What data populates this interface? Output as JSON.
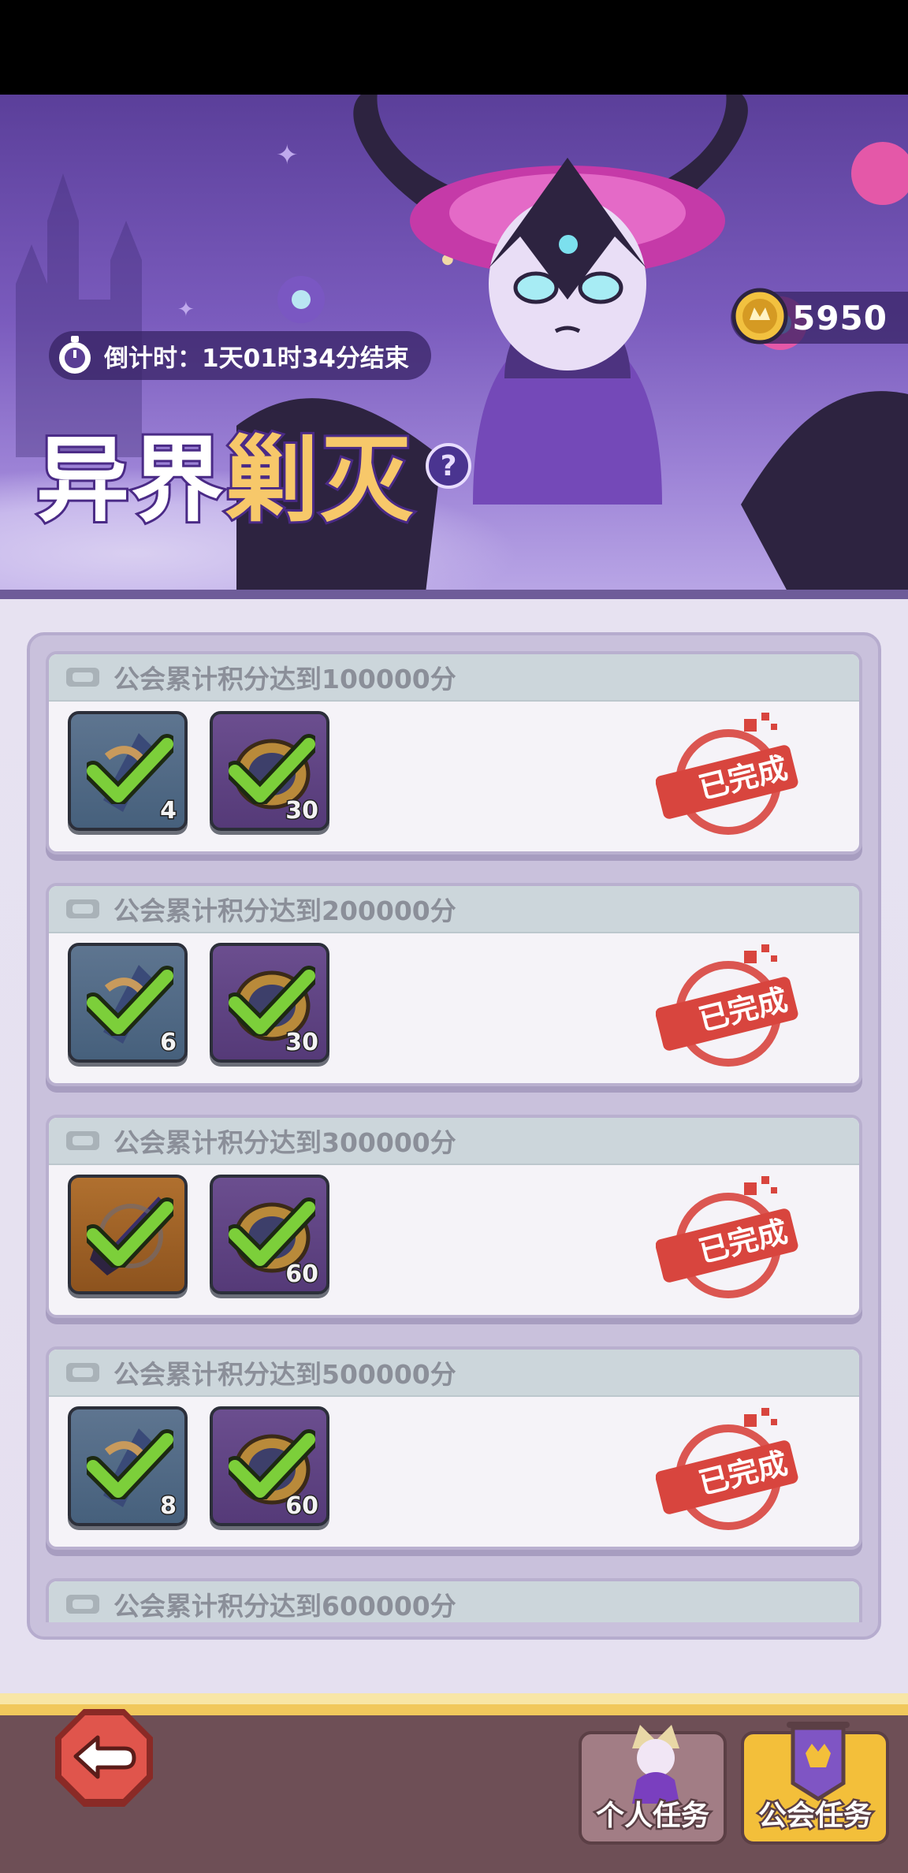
{
  "header": {
    "countdown": "倒计时：1天01时34分结束",
    "title_white": "异界",
    "title_gold": "剿灭",
    "help_symbol": "?",
    "currency_value": "5950"
  },
  "tasks": [
    {
      "title": "公会累计积分达到100000分",
      "rewards": [
        {
          "tier": "blue",
          "qty": "4"
        },
        {
          "tier": "purple",
          "qty": "30"
        }
      ],
      "status": "已完成"
    },
    {
      "title": "公会累计积分达到200000分",
      "rewards": [
        {
          "tier": "blue",
          "qty": "6"
        },
        {
          "tier": "purple",
          "qty": "30"
        }
      ],
      "status": "已完成"
    },
    {
      "title": "公会累计积分达到300000分",
      "rewards": [
        {
          "tier": "orange",
          "qty": ""
        },
        {
          "tier": "purple",
          "qty": "60"
        }
      ],
      "status": "已完成"
    },
    {
      "title": "公会累计积分达到500000分",
      "rewards": [
        {
          "tier": "blue",
          "qty": "8"
        },
        {
          "tier": "purple",
          "qty": "60"
        }
      ],
      "status": "已完成"
    },
    {
      "title": "公会累计积分达到600000分",
      "rewards": [],
      "status": ""
    }
  ],
  "nav": {
    "personal_tab": "个人任务",
    "guild_tab": "公会任务"
  },
  "colors": {
    "stamp_red": "#d8453e",
    "check_green": "#7ccf3a",
    "banner_purple": "#6a4caa",
    "guild_tab_gold": "#f3bf3a"
  }
}
